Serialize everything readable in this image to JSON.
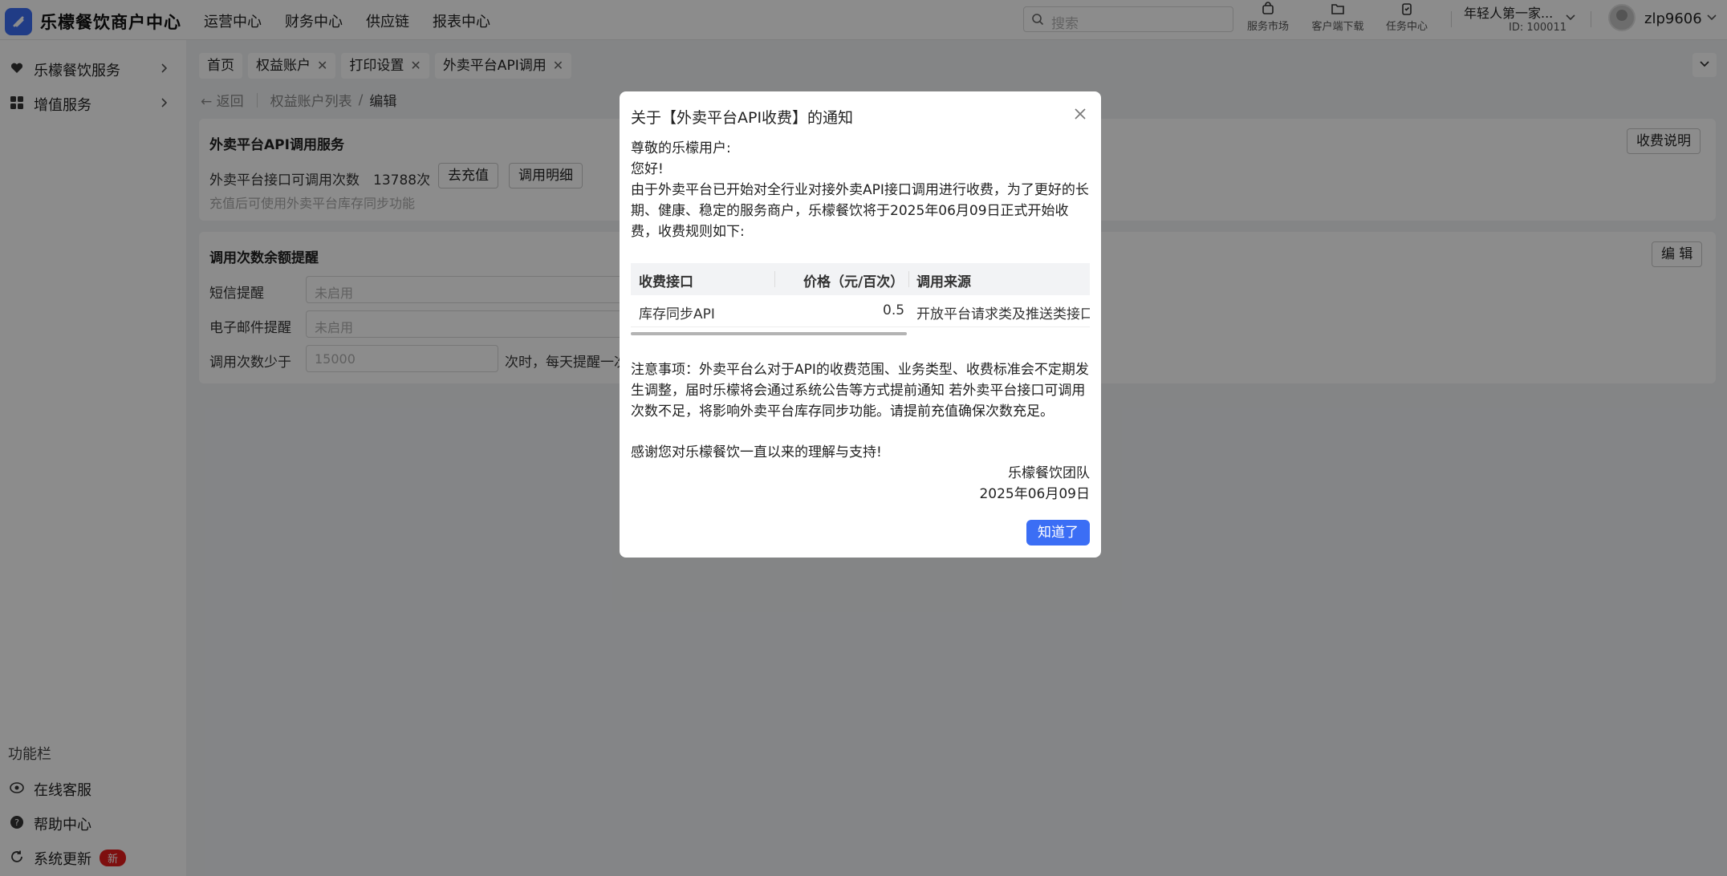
{
  "app": {
    "title": "乐檬餐饮商户中心"
  },
  "topnav": [
    "运营中心",
    "财务中心",
    "供应链",
    "报表中心"
  ],
  "search": {
    "placeholder": "搜索"
  },
  "tools": [
    "服务市场",
    "客户端下载",
    "任务中心"
  ],
  "store": {
    "name": "年轻人第一家...",
    "id": "ID: 100011"
  },
  "user": {
    "name": "zlp9606"
  },
  "sidebar": {
    "items": [
      "乐檬餐饮服务",
      "增值服务"
    ],
    "func_title": "功能栏",
    "func_items": [
      "在线客服",
      "帮助中心",
      "系统更新"
    ],
    "new_badge": "新"
  },
  "tabs": [
    {
      "label": "首页",
      "closable": false
    },
    {
      "label": "权益账户",
      "closable": true
    },
    {
      "label": "打印设置",
      "closable": true
    },
    {
      "label": "外卖平台API调用",
      "closable": true
    }
  ],
  "breadcrumb": {
    "back": "返回",
    "parent": "权益账户列表",
    "current": "编辑"
  },
  "card1": {
    "title": "外卖平台API调用服务",
    "count_label": "外卖平台接口可调用次数",
    "count_value": "13788次",
    "recharge_btn": "去充值",
    "detail_btn": "调用明细",
    "hint": "充值后可使用外卖平台库存同步功能",
    "fee_btn": "收费说明"
  },
  "card2": {
    "title": "调用次数余额提醒",
    "edit_btn": "编 辑",
    "sms_label": "短信提醒",
    "sms_placeholder": "未启用",
    "email_label": "电子邮件提醒",
    "email_placeholder": "未启用",
    "threshold_label": "调用次数少于",
    "threshold_placeholder": "15000",
    "threshold_suffix": "次时，每天提醒一次"
  },
  "dialog": {
    "title": "关于【外卖平台API收费】的通知",
    "greeting": "尊敬的乐檬用户:",
    "hello": "您好!",
    "body": "由于外卖平台已开始对全行业对接外卖API接口调用进行收费，为了更好的长期、健康、稳定的服务商户，乐檬餐饮将于2025年06月09日正式开始收费，收费规则如下:",
    "table": {
      "headers": [
        "收费接口",
        "价格（元/百次）",
        "调用来源"
      ],
      "rows": [
        [
          "库存同步API",
          "0.5",
          "开放平台请求类及推送类接口"
        ]
      ]
    },
    "note": "注意事项：外卖平台么对于API的收费范围、业务类型、收费标准会不定期发生调整，届时乐檬将会通过系统公告等方式提前通知 若外卖平台接口可调用次数不足，将影响外卖平台库存同步功能。请提前充值确保次数充足。",
    "thanks": "感谢您对乐檬餐饮一直以来的理解与支持!",
    "signature": "乐檬餐饮团队",
    "date": "2025年06月09日",
    "ok_btn": "知道了"
  }
}
